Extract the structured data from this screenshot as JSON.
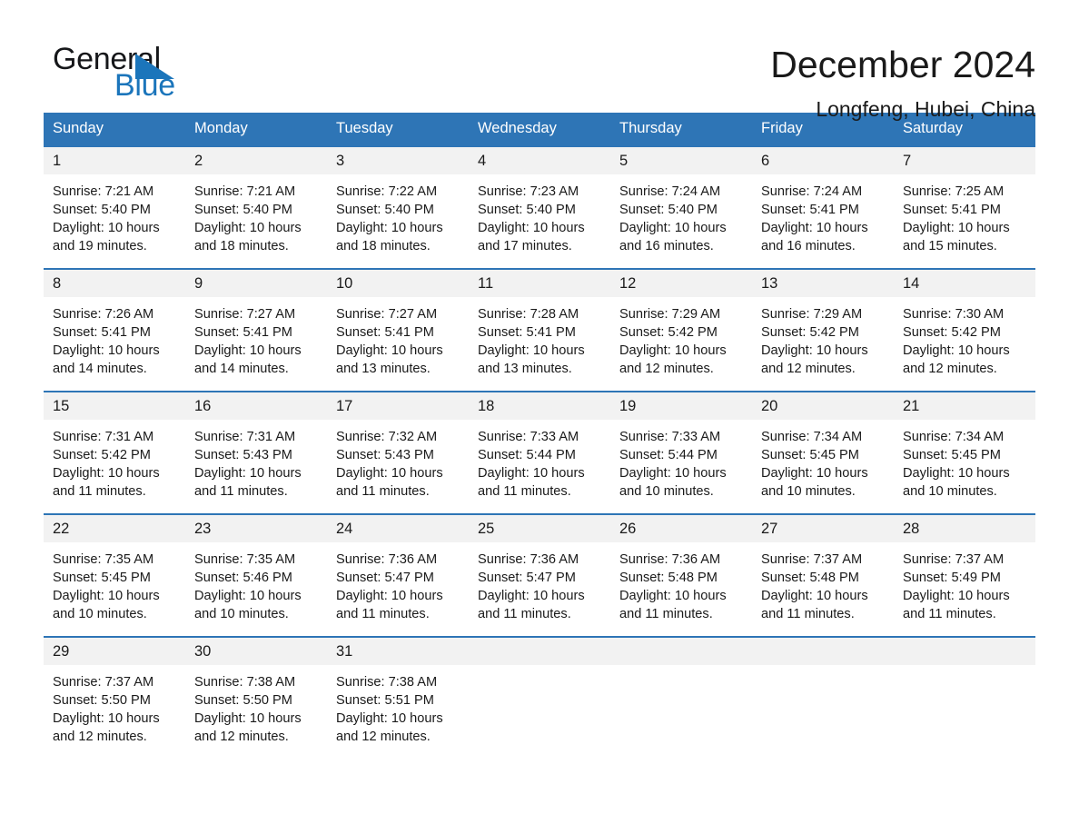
{
  "brand": {
    "name_top": "General",
    "name_bottom": "Blue",
    "color_primary": "#1B75BB",
    "color_text": "#16171A"
  },
  "header": {
    "title": "December 2024",
    "subtitle": "Longfeng, Hubei, China"
  },
  "theme": {
    "header_bg": "#2E75B6",
    "header_text": "#FFFFFF",
    "daynum_bg": "#F2F2F2",
    "cell_bg": "#FFFFFF",
    "week_border": "#2E75B6"
  },
  "weekdays": [
    "Sunday",
    "Monday",
    "Tuesday",
    "Wednesday",
    "Thursday",
    "Friday",
    "Saturday"
  ],
  "weeks": [
    [
      {
        "day": "1",
        "info": "Sunrise: 7:21 AM\nSunset: 5:40 PM\nDaylight: 10 hours and 19 minutes."
      },
      {
        "day": "2",
        "info": "Sunrise: 7:21 AM\nSunset: 5:40 PM\nDaylight: 10 hours and 18 minutes."
      },
      {
        "day": "3",
        "info": "Sunrise: 7:22 AM\nSunset: 5:40 PM\nDaylight: 10 hours and 18 minutes."
      },
      {
        "day": "4",
        "info": "Sunrise: 7:23 AM\nSunset: 5:40 PM\nDaylight: 10 hours and 17 minutes."
      },
      {
        "day": "5",
        "info": "Sunrise: 7:24 AM\nSunset: 5:40 PM\nDaylight: 10 hours and 16 minutes."
      },
      {
        "day": "6",
        "info": "Sunrise: 7:24 AM\nSunset: 5:41 PM\nDaylight: 10 hours and 16 minutes."
      },
      {
        "day": "7",
        "info": "Sunrise: 7:25 AM\nSunset: 5:41 PM\nDaylight: 10 hours and 15 minutes."
      }
    ],
    [
      {
        "day": "8",
        "info": "Sunrise: 7:26 AM\nSunset: 5:41 PM\nDaylight: 10 hours and 14 minutes."
      },
      {
        "day": "9",
        "info": "Sunrise: 7:27 AM\nSunset: 5:41 PM\nDaylight: 10 hours and 14 minutes."
      },
      {
        "day": "10",
        "info": "Sunrise: 7:27 AM\nSunset: 5:41 PM\nDaylight: 10 hours and 13 minutes."
      },
      {
        "day": "11",
        "info": "Sunrise: 7:28 AM\nSunset: 5:41 PM\nDaylight: 10 hours and 13 minutes."
      },
      {
        "day": "12",
        "info": "Sunrise: 7:29 AM\nSunset: 5:42 PM\nDaylight: 10 hours and 12 minutes."
      },
      {
        "day": "13",
        "info": "Sunrise: 7:29 AM\nSunset: 5:42 PM\nDaylight: 10 hours and 12 minutes."
      },
      {
        "day": "14",
        "info": "Sunrise: 7:30 AM\nSunset: 5:42 PM\nDaylight: 10 hours and 12 minutes."
      }
    ],
    [
      {
        "day": "15",
        "info": "Sunrise: 7:31 AM\nSunset: 5:42 PM\nDaylight: 10 hours and 11 minutes."
      },
      {
        "day": "16",
        "info": "Sunrise: 7:31 AM\nSunset: 5:43 PM\nDaylight: 10 hours and 11 minutes."
      },
      {
        "day": "17",
        "info": "Sunrise: 7:32 AM\nSunset: 5:43 PM\nDaylight: 10 hours and 11 minutes."
      },
      {
        "day": "18",
        "info": "Sunrise: 7:33 AM\nSunset: 5:44 PM\nDaylight: 10 hours and 11 minutes."
      },
      {
        "day": "19",
        "info": "Sunrise: 7:33 AM\nSunset: 5:44 PM\nDaylight: 10 hours and 10 minutes."
      },
      {
        "day": "20",
        "info": "Sunrise: 7:34 AM\nSunset: 5:45 PM\nDaylight: 10 hours and 10 minutes."
      },
      {
        "day": "21",
        "info": "Sunrise: 7:34 AM\nSunset: 5:45 PM\nDaylight: 10 hours and 10 minutes."
      }
    ],
    [
      {
        "day": "22",
        "info": "Sunrise: 7:35 AM\nSunset: 5:45 PM\nDaylight: 10 hours and 10 minutes."
      },
      {
        "day": "23",
        "info": "Sunrise: 7:35 AM\nSunset: 5:46 PM\nDaylight: 10 hours and 10 minutes."
      },
      {
        "day": "24",
        "info": "Sunrise: 7:36 AM\nSunset: 5:47 PM\nDaylight: 10 hours and 11 minutes."
      },
      {
        "day": "25",
        "info": "Sunrise: 7:36 AM\nSunset: 5:47 PM\nDaylight: 10 hours and 11 minutes."
      },
      {
        "day": "26",
        "info": "Sunrise: 7:36 AM\nSunset: 5:48 PM\nDaylight: 10 hours and 11 minutes."
      },
      {
        "day": "27",
        "info": "Sunrise: 7:37 AM\nSunset: 5:48 PM\nDaylight: 10 hours and 11 minutes."
      },
      {
        "day": "28",
        "info": "Sunrise: 7:37 AM\nSunset: 5:49 PM\nDaylight: 10 hours and 11 minutes."
      }
    ],
    [
      {
        "day": "29",
        "info": "Sunrise: 7:37 AM\nSunset: 5:50 PM\nDaylight: 10 hours and 12 minutes."
      },
      {
        "day": "30",
        "info": "Sunrise: 7:38 AM\nSunset: 5:50 PM\nDaylight: 10 hours and 12 minutes."
      },
      {
        "day": "31",
        "info": "Sunrise: 7:38 AM\nSunset: 5:51 PM\nDaylight: 10 hours and 12 minutes."
      },
      {
        "day": "",
        "info": ""
      },
      {
        "day": "",
        "info": ""
      },
      {
        "day": "",
        "info": ""
      },
      {
        "day": "",
        "info": ""
      }
    ]
  ]
}
